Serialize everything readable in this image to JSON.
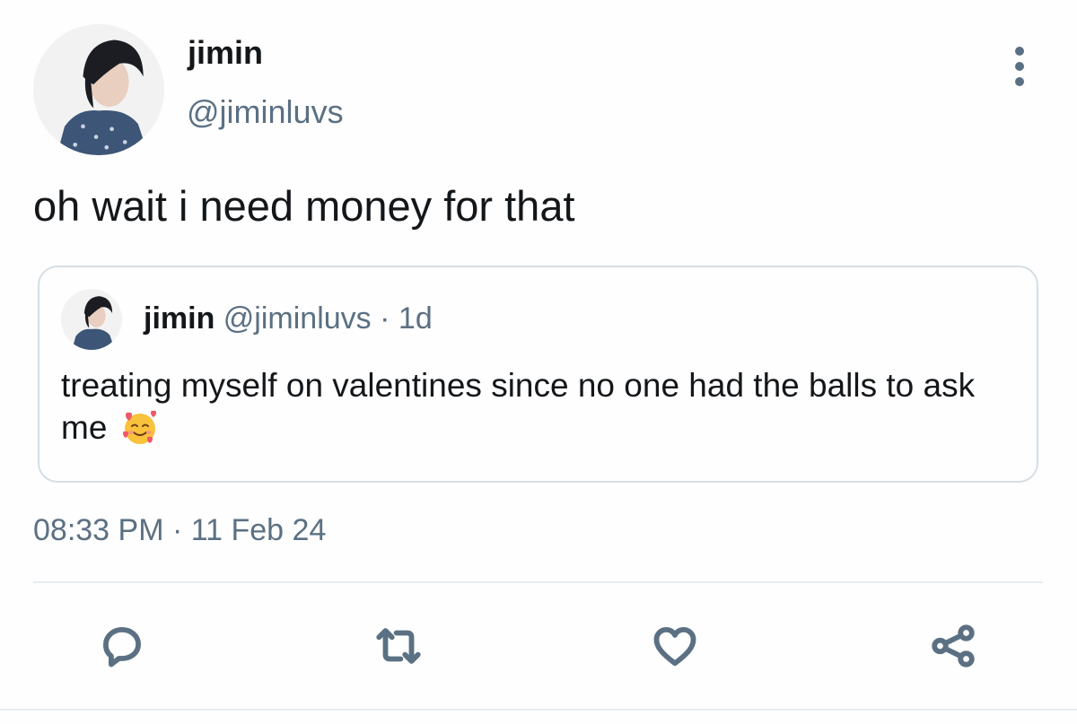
{
  "tweet": {
    "author": {
      "name": "jimin",
      "handle": "@jiminluvs"
    },
    "text": "oh wait i need money for that",
    "timestamp": {
      "time": "08:33 PM",
      "separator": "·",
      "date": "11 Feb 24"
    }
  },
  "quote": {
    "name": "jimin",
    "handle": "@jiminluvs",
    "separator": "·",
    "age": "1d",
    "text": "treating myself on valentines since no one had the balls to ask me",
    "emoji": "smiling-face-with-hearts"
  },
  "actions": [
    {
      "icon": "reply-icon"
    },
    {
      "icon": "retweet-icon"
    },
    {
      "icon": "like-icon"
    },
    {
      "icon": "share-icon"
    }
  ],
  "colors": {
    "text": "#14171a",
    "secondary": "#5b7083",
    "border": "#d5dee4",
    "divider": "#e6ecf0"
  }
}
